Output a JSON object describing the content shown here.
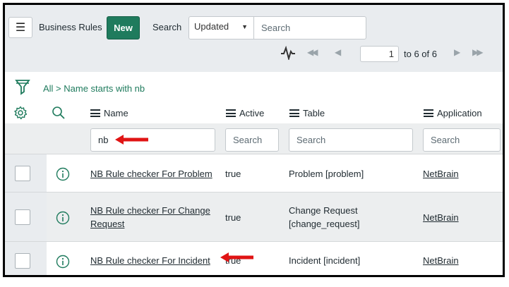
{
  "header": {
    "title": "Business Rules",
    "new_label": "New",
    "search_label": "Search",
    "search_field": "Updated",
    "search_placeholder": "Search"
  },
  "pagination": {
    "current_page": "1",
    "range_text": "to 6 of 6"
  },
  "breadcrumb": "All > Name starts with nb",
  "columns": {
    "name": "Name",
    "active": "Active",
    "table": "Table",
    "application": "Application"
  },
  "filters": {
    "name_value": "nb",
    "active_placeholder": "Search",
    "table_placeholder": "Search",
    "application_placeholder": "Search"
  },
  "rows": [
    {
      "name": "NB Rule checker For Problem",
      "active": "true",
      "table": "Problem [problem]",
      "application": "NetBrain"
    },
    {
      "name_line1": "NB Rule checker For Change",
      "name_line2": "Request",
      "active": "true",
      "table_line1": "Change Request",
      "table_line2": "[change_request]",
      "application": "NetBrain"
    },
    {
      "name": "NB Rule checker For Incident",
      "active": "true",
      "table": "Incident [incident]",
      "application": "NetBrain"
    }
  ],
  "colors": {
    "accent": "#1f7b5d",
    "annotation_arrow": "#e01414",
    "header_bg": "#e9ecef"
  }
}
